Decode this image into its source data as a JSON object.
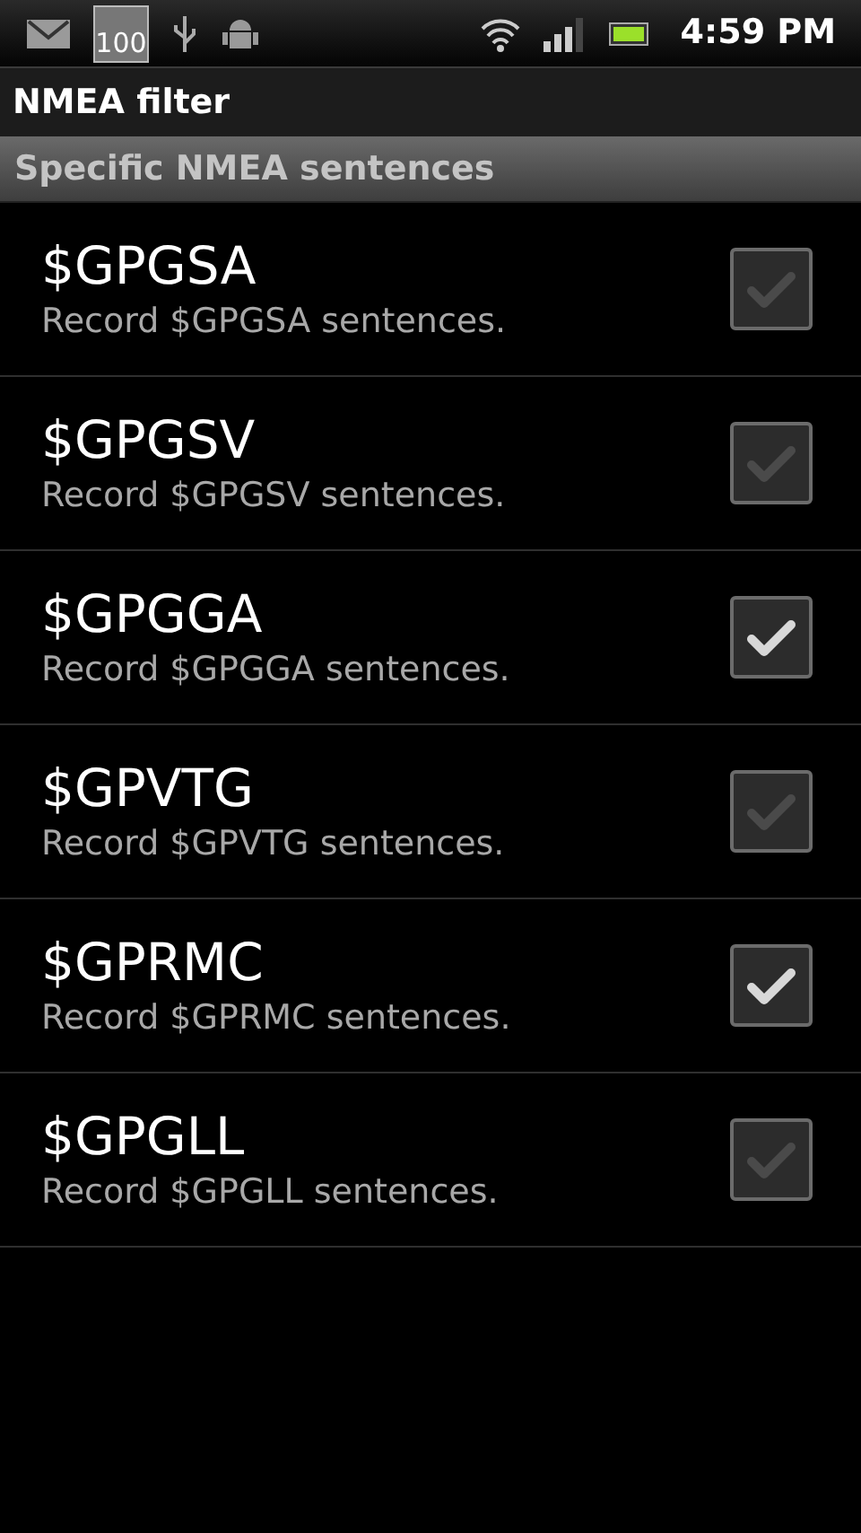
{
  "status_bar": {
    "notification_count": "100",
    "time": "4:59 PM"
  },
  "title": "NMEA filter",
  "section": {
    "title": "Specific NMEA sentences"
  },
  "items": [
    {
      "title": "$GPGSA",
      "summary": "Record $GPGSA sentences.",
      "checked": false
    },
    {
      "title": "$GPGSV",
      "summary": "Record $GPGSV sentences.",
      "checked": false
    },
    {
      "title": "$GPGGA",
      "summary": "Record $GPGGA sentences.",
      "checked": true
    },
    {
      "title": "$GPVTG",
      "summary": "Record $GPVTG sentences.",
      "checked": false
    },
    {
      "title": "$GPRMC",
      "summary": "Record $GPRMC sentences.",
      "checked": true
    },
    {
      "title": "$GPGLL",
      "summary": "Record $GPGLL sentences.",
      "checked": false
    }
  ]
}
